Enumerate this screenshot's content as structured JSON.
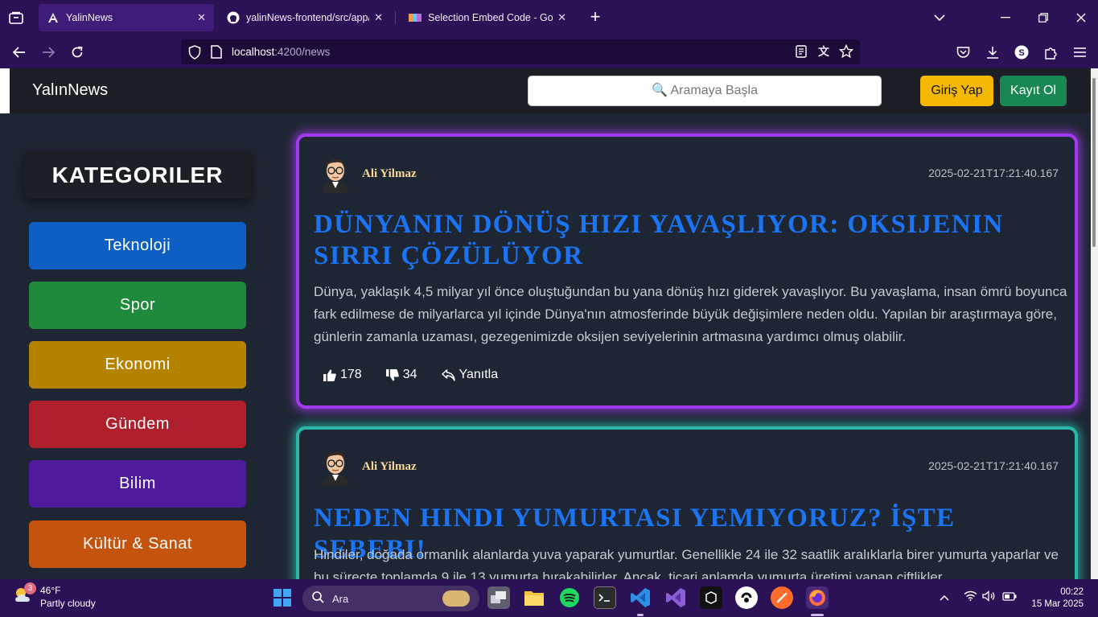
{
  "browser": {
    "tabs": [
      {
        "title": "YalinNews",
        "icon": "angular-icon",
        "active": true
      },
      {
        "title": "yalinNews-frontend/src/app/co",
        "icon": "github-icon",
        "active": false
      },
      {
        "title": "Selection Embed Code - Google",
        "icon": "iconify-icon",
        "active": false
      }
    ],
    "url_host": "localhost",
    "url_path": ":4200/news",
    "theme_color": "#2b1155"
  },
  "site": {
    "brand": "YalınNews",
    "search_placeholder": "🔍 Aramaya Başla",
    "login_label": "Giriş Yap",
    "signup_label": "Kayıt Ol"
  },
  "sidebar": {
    "title": "KATEGORILER",
    "categories": [
      {
        "label": "Teknoloji",
        "color": "#0e5fc3"
      },
      {
        "label": "Spor",
        "color": "#1f8a3b"
      },
      {
        "label": "Ekonomi",
        "color": "#b58300"
      },
      {
        "label": "Gündem",
        "color": "#b01f2c"
      },
      {
        "label": "Bilim",
        "color": "#4f1a9c"
      },
      {
        "label": "Kültür & Sanat",
        "color": "#c4530d"
      }
    ]
  },
  "posts": [
    {
      "author": "Ali Yilmaz",
      "date": "2025-02-21T17:21:40.167",
      "headline": "DÜNYANIN DÖNÜŞ HIZI YAVAŞLIYOR: OKSIJENIN SIRRI ÇÖZÜLÜYOR",
      "body": "Dünya, yaklaşık 4,5 milyar yıl önce oluştuğundan bu yana dönüş hızı giderek yavaşlıyor. Bu yavaşlama, insan ömrü boyunca fark edilmese de milyarlarca yıl içinde Dünya'nın atmosferinde büyük değişimlere neden oldu. Yapılan bir araştırmaya göre, günlerin zamanla uzaması, gezegenimizde oksijen seviyelerinin artmasına yardımcı olmuş olabilir.",
      "likes": "178",
      "dislikes": "34",
      "reply_label": "Yanıtla",
      "border_color": "#a23bf0"
    },
    {
      "author": "Ali Yilmaz",
      "date": "2025-02-21T17:21:40.167",
      "headline": "NEDEN HINDI YUMURTASI YEMIYORUZ? İŞTE SEBEBI!",
      "body": "Hindiler, doğada ormanlık alanlarda yuva yaparak yumurtlar. Genellikle 24 ile 32 saatlik aralıklarla birer yumurta yaparlar ve bu süreçte toplamda 9 ile 13 yumurta bırakabilirler. Ancak, ticari anlamda yumurta üretimi yapan çiftlikler",
      "border_color": "#29b7a8"
    }
  ],
  "taskbar": {
    "weather_temp": "46°F",
    "weather_desc": "Partly cloudy",
    "weather_badge": "3",
    "search_label": "Ara",
    "time": "00:22",
    "date": "15 Mar 2025"
  }
}
